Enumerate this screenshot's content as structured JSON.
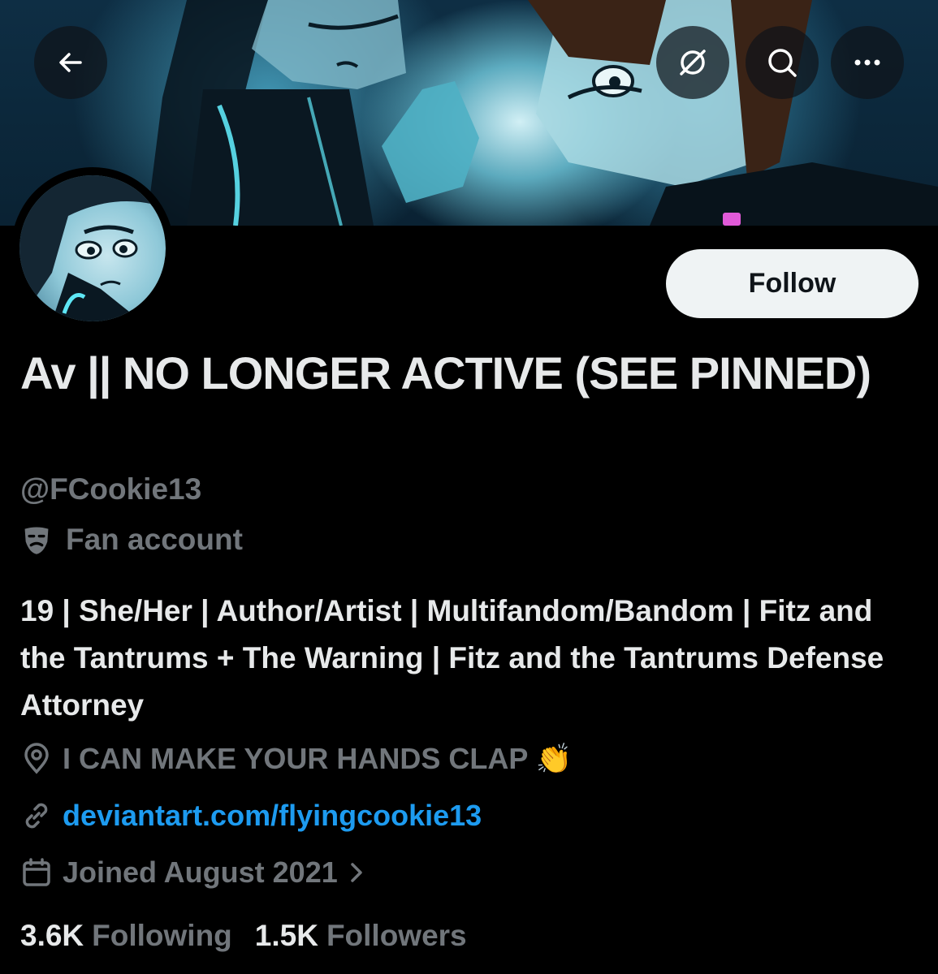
{
  "header": {
    "back_icon": "arrow-left-icon",
    "grok_icon": "grok-icon",
    "search_icon": "search-icon",
    "more_icon": "more-horizontal-icon"
  },
  "profile": {
    "display_name": "Av || NO LONGER ACTIVE (SEE PINNED)",
    "handle": "@FCookie13",
    "category_icon": "theater-mask-icon",
    "category": "Fan account",
    "bio": "19 | She/Her | Author/Artist | Multifandom/Bandom | Fitz and the Tantrums + The Warning | Fitz and the Tantrums Defense Attorney",
    "location": "I CAN MAKE YOUR HANDS CLAP 👏",
    "website": "deviantart.com/flyingcookie13",
    "joined": "Joined August 2021",
    "follow_label": "Follow"
  },
  "stats": {
    "following_count": "3.6K",
    "following_label": "Following",
    "followers_count": "1.5K",
    "followers_label": "Followers"
  },
  "colors": {
    "background": "#000000",
    "text_primary": "#e7e9ea",
    "text_secondary": "#71767b",
    "link": "#1d9bf0",
    "follow_button": "#eff3f4"
  }
}
